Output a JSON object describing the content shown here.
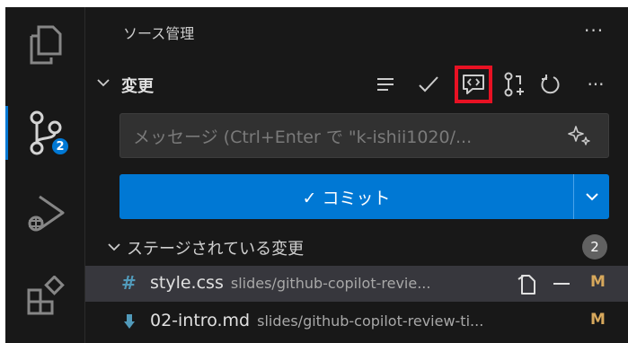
{
  "panel": {
    "title": "ソース管理",
    "more": "···"
  },
  "activity": {
    "scm_badge": "2"
  },
  "changes": {
    "label": "変更",
    "more": "···"
  },
  "message": {
    "placeholder": "メッセージ (Ctrl+Enter で \"k-ishii1020/..."
  },
  "commit": {
    "label": "✓ コミット"
  },
  "staged": {
    "label": "ステージされている変更",
    "count": "2"
  },
  "files": [
    {
      "icon": "#",
      "name": "style.css",
      "path": "slides/github-copilot-revie...",
      "status": "M",
      "icon_color": "#519aba"
    },
    {
      "icon": "🠗",
      "name": "02-intro.md",
      "path": "slides/github-copilot-review-ti...",
      "status": "M",
      "icon_color": "#519aba"
    }
  ],
  "colors": {
    "accent": "#0078d4",
    "highlight_box": "#e81123",
    "modified": "#d7a85c"
  }
}
